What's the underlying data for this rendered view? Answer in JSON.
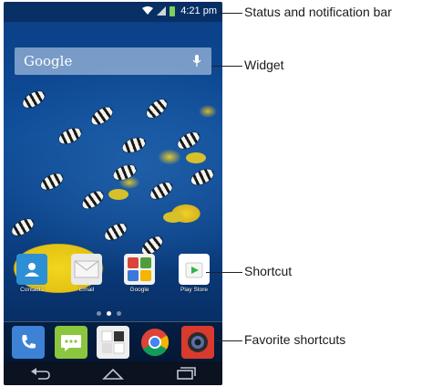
{
  "phone": {
    "status_bar": {
      "time": "4:21 pm"
    },
    "widget": {
      "label": "Google"
    },
    "shortcuts": [
      {
        "label": "Contacts",
        "icon": "contacts-icon",
        "color": "#2d8fd4"
      },
      {
        "label": "Email",
        "icon": "email-icon",
        "color": "#e9e9e9"
      },
      {
        "label": "Google",
        "icon": "google-folder-icon",
        "color": "#f2f2f2"
      },
      {
        "label": "Play Store",
        "icon": "play-store-icon",
        "color": "#ffffff"
      }
    ],
    "page_indicator": {
      "count": 3,
      "active": 1
    },
    "dock": [
      {
        "icon": "phone-icon",
        "color": "#3e82d6"
      },
      {
        "icon": "messaging-icon",
        "color": "#8cc63f"
      },
      {
        "icon": "app-drawer-icon",
        "color": "#eeeeee"
      },
      {
        "icon": "chrome-icon",
        "color": "#ffffff"
      },
      {
        "icon": "camera-icon",
        "color": "#d83a2e"
      }
    ],
    "nav": [
      "back-icon",
      "home-icon",
      "recent-apps-icon"
    ]
  },
  "callouts": {
    "status": "Status and notification bar",
    "widget": "Widget",
    "shortcut": "Shortcut",
    "favorites": "Favorite shortcuts"
  }
}
